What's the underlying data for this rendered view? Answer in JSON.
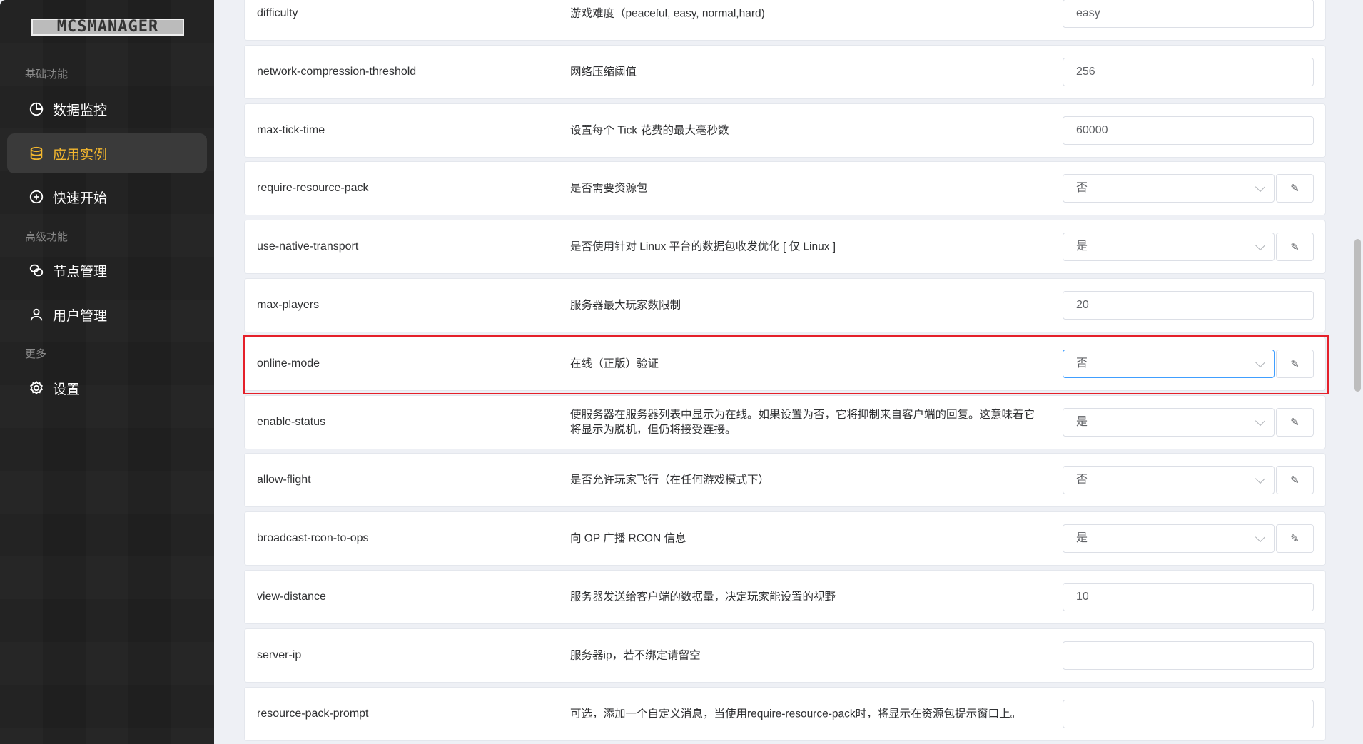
{
  "sidebar": {
    "logo": "MCSMANAGER",
    "groups": [
      "基础功能",
      "高级功能",
      "更多"
    ],
    "items": [
      {
        "label": "数据监控",
        "icon": "pie-chart-icon"
      },
      {
        "label": "应用实例",
        "icon": "database-icon",
        "active": true
      },
      {
        "label": "快速开始",
        "icon": "plus-circle-icon"
      },
      {
        "label": "节点管理",
        "icon": "nodes-icon"
      },
      {
        "label": "用户管理",
        "icon": "user-icon"
      },
      {
        "label": "设置",
        "icon": "gear-icon"
      }
    ]
  },
  "accent": "#f5b82e",
  "rows": [
    {
      "key": "difficulty",
      "desc": "游戏难度（peaceful, easy, normal,hard)",
      "type": "input",
      "value": "easy"
    },
    {
      "key": "network-compression-threshold",
      "desc": "网络压缩阈值",
      "type": "input",
      "value": "256"
    },
    {
      "key": "max-tick-time",
      "desc": "设置每个 Tick 花费的最大毫秒数",
      "type": "input",
      "value": "60000"
    },
    {
      "key": "require-resource-pack",
      "desc": "是否需要资源包",
      "type": "select",
      "value": "否"
    },
    {
      "key": "use-native-transport",
      "desc": "是否使用针对 Linux 平台的数据包收发优化 [ 仅 Linux ]",
      "type": "select",
      "value": "是"
    },
    {
      "key": "max-players",
      "desc": "服务器最大玩家数限制",
      "type": "input",
      "value": "20"
    },
    {
      "key": "online-mode",
      "desc": "在线（正版）验证",
      "type": "select",
      "value": "否",
      "highlighted": true
    },
    {
      "key": "enable-status",
      "desc": "使服务器在服务器列表中显示为在线。如果设置为否，它将抑制来自客户端的回复。这意味着它将显示为脱机，但仍将接受连接。",
      "type": "select",
      "value": "是"
    },
    {
      "key": "allow-flight",
      "desc": "是否允许玩家飞行（在任何游戏模式下）",
      "type": "select",
      "value": "否"
    },
    {
      "key": "broadcast-rcon-to-ops",
      "desc": "向 OP 广播 RCON 信息",
      "type": "select",
      "value": "是"
    },
    {
      "key": "view-distance",
      "desc": "服务器发送给客户端的数据量，决定玩家能设置的视野",
      "type": "input",
      "value": "10"
    },
    {
      "key": "server-ip",
      "desc": "服务器ip，若不绑定请留空",
      "type": "input",
      "value": ""
    },
    {
      "key": "resource-pack-prompt",
      "desc": "可选，添加一个自定义消息，当使用require-resource-pack时，将显示在资源包提示窗口上。",
      "type": "input",
      "value": ""
    }
  ]
}
